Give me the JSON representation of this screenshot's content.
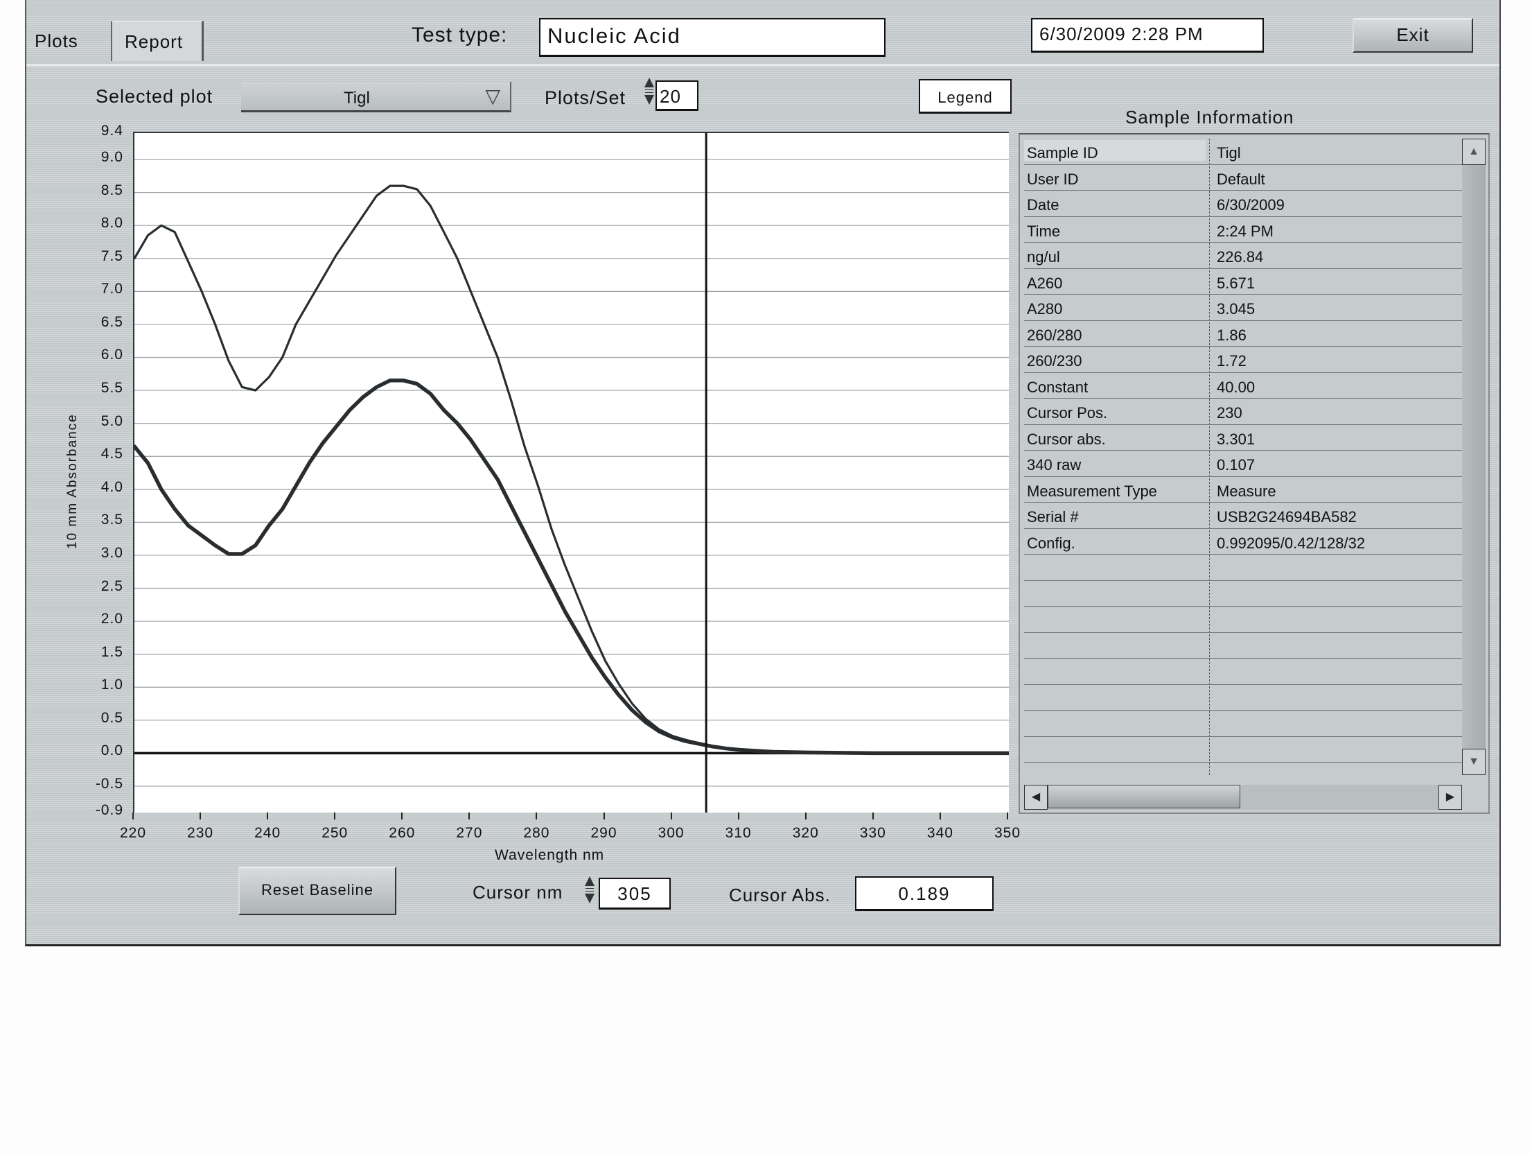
{
  "tabs": [
    {
      "label": "Plots",
      "active": true
    },
    {
      "label": "Report",
      "active": false
    }
  ],
  "header": {
    "test_type_label": "Test type:",
    "test_type_value": "Nucleic Acid",
    "datetime": "6/30/2009  2:28 PM",
    "exit_label": "Exit"
  },
  "controls": {
    "selected_plot_label": "Selected plot",
    "selected_plot_value": "Tigl",
    "plots_per_set_label": "Plots/Set",
    "plots_per_set_value": "20",
    "legend_label": "Legend",
    "reset_baseline_label": "Reset Baseline",
    "cursor_nm_label": "Cursor nm",
    "cursor_nm_value": "305",
    "cursor_abs_label": "Cursor Abs.",
    "cursor_abs_value": "0.189"
  },
  "sample_info": {
    "title": "Sample Information",
    "rows": [
      {
        "key": "Sample ID",
        "value": "Tigl"
      },
      {
        "key": "User ID",
        "value": "Default"
      },
      {
        "key": "Date",
        "value": "6/30/2009"
      },
      {
        "key": "Time",
        "value": "2:24 PM"
      },
      {
        "key": "ng/ul",
        "value": "226.84"
      },
      {
        "key": "A260",
        "value": "5.671"
      },
      {
        "key": "A280",
        "value": "3.045"
      },
      {
        "key": "260/280",
        "value": "1.86"
      },
      {
        "key": "260/230",
        "value": "1.72"
      },
      {
        "key": "Constant",
        "value": "40.00"
      },
      {
        "key": "Cursor Pos.",
        "value": "230"
      },
      {
        "key": "Cursor abs.",
        "value": "3.301"
      },
      {
        "key": "340 raw",
        "value": "0.107"
      },
      {
        "key": "Measurement Type",
        "value": "Measure"
      },
      {
        "key": "Serial #",
        "value": "USB2G24694BA582"
      },
      {
        "key": "Config.",
        "value": "0.992095/0.42/128/32"
      },
      {
        "key": "",
        "value": ""
      },
      {
        "key": "",
        "value": ""
      },
      {
        "key": "",
        "value": ""
      },
      {
        "key": "",
        "value": ""
      },
      {
        "key": "",
        "value": ""
      },
      {
        "key": "",
        "value": ""
      },
      {
        "key": "",
        "value": ""
      },
      {
        "key": "",
        "value": ""
      }
    ]
  },
  "chart_data": {
    "type": "line",
    "title": "",
    "xlabel": "Wavelength nm",
    "ylabel": "10 mm Absorbance",
    "xlim": [
      220,
      350
    ],
    "ylim": [
      -0.9,
      9.4
    ],
    "xticks": [
      "220",
      "230",
      "240",
      "250",
      "260",
      "270",
      "280",
      "290",
      "300",
      "310",
      "320",
      "330",
      "340",
      "350"
    ],
    "yticks": [
      "9.4",
      "9.0",
      "8.5",
      "8.0",
      "7.5",
      "7.0",
      "6.5",
      "6.0",
      "5.5",
      "5.0",
      "4.5",
      "4.0",
      "3.5",
      "3.0",
      "2.5",
      "2.0",
      "1.5",
      "1.0",
      "0.5",
      "0.0",
      "-0.5",
      "-0.9"
    ],
    "ytick_values": [
      9.4,
      9.0,
      8.5,
      8.0,
      7.5,
      7.0,
      6.5,
      6.0,
      5.5,
      5.0,
      4.5,
      4.0,
      3.5,
      3.0,
      2.5,
      2.0,
      1.5,
      1.0,
      0.5,
      0.0,
      -0.5,
      -0.9
    ],
    "grid": true,
    "cursor_x": 305,
    "baseline_y": 0,
    "series": [
      {
        "name": "upper",
        "x": [
          220,
          222,
          224,
          226,
          228,
          230,
          232,
          234,
          236,
          238,
          240,
          242,
          244,
          246,
          248,
          250,
          252,
          254,
          256,
          258,
          260,
          262,
          264,
          266,
          268,
          270,
          272,
          274,
          276,
          278,
          280,
          282,
          284,
          286,
          288,
          290,
          292,
          294,
          296,
          298,
          300,
          302,
          304,
          306,
          308,
          310,
          315,
          320,
          330,
          340,
          350
        ],
        "y": [
          7.5,
          7.85,
          8.0,
          7.9,
          7.45,
          7.0,
          6.5,
          5.95,
          5.55,
          5.5,
          5.7,
          6.0,
          6.5,
          6.85,
          7.2,
          7.55,
          7.85,
          8.15,
          8.45,
          8.6,
          8.6,
          8.55,
          8.3,
          7.9,
          7.5,
          7.0,
          6.5,
          6.0,
          5.35,
          4.65,
          4.05,
          3.4,
          2.85,
          2.35,
          1.85,
          1.4,
          1.05,
          0.75,
          0.52,
          0.36,
          0.26,
          0.2,
          0.15,
          0.1,
          0.07,
          0.05,
          0.02,
          0.01,
          0.0,
          0.0,
          0.0
        ]
      },
      {
        "name": "lower",
        "x": [
          220,
          222,
          224,
          226,
          228,
          230,
          232,
          234,
          236,
          238,
          240,
          242,
          244,
          246,
          248,
          250,
          252,
          254,
          256,
          258,
          260,
          262,
          264,
          266,
          268,
          270,
          272,
          274,
          276,
          278,
          280,
          282,
          284,
          286,
          288,
          290,
          292,
          294,
          296,
          298,
          300,
          302,
          304,
          306,
          308,
          310,
          315,
          320,
          330,
          340,
          350
        ],
        "y": [
          4.65,
          4.4,
          4.0,
          3.7,
          3.45,
          3.3,
          3.15,
          3.02,
          3.02,
          3.15,
          3.45,
          3.7,
          4.05,
          4.4,
          4.7,
          4.95,
          5.2,
          5.4,
          5.55,
          5.65,
          5.65,
          5.6,
          5.45,
          5.2,
          5.0,
          4.75,
          4.45,
          4.15,
          3.75,
          3.35,
          2.95,
          2.55,
          2.15,
          1.8,
          1.45,
          1.15,
          0.88,
          0.65,
          0.47,
          0.33,
          0.24,
          0.18,
          0.14,
          0.1,
          0.07,
          0.05,
          0.02,
          0.01,
          0.0,
          0.0,
          0.0
        ]
      }
    ]
  }
}
